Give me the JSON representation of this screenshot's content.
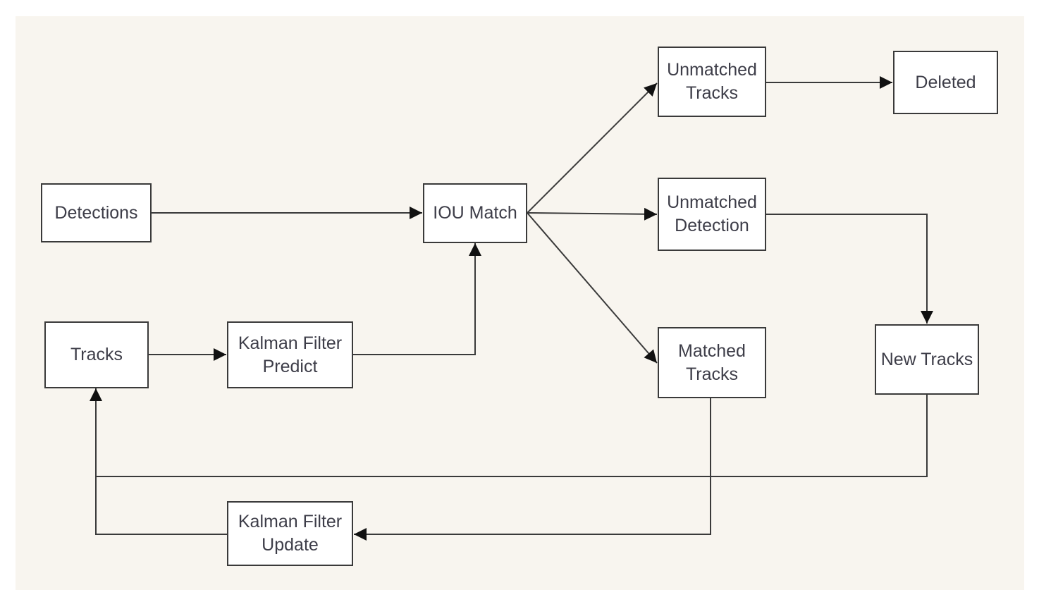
{
  "diagram": {
    "title": "",
    "nodes": [
      {
        "id": "detections",
        "label": "Detections"
      },
      {
        "id": "tracks",
        "label": "Tracks"
      },
      {
        "id": "kf_predict",
        "label": "Kalman Filter\nPredict"
      },
      {
        "id": "iou_match",
        "label": "IOU Match"
      },
      {
        "id": "unmatched_tracks",
        "label": "Unmatched\nTracks"
      },
      {
        "id": "deleted",
        "label": "Deleted"
      },
      {
        "id": "unmatched_detection",
        "label": "Unmatched\nDetection"
      },
      {
        "id": "matched_tracks",
        "label": "Matched\nTracks"
      },
      {
        "id": "new_tracks",
        "label": "New Tracks"
      },
      {
        "id": "kf_update",
        "label": "Kalman Filter\nUpdate"
      }
    ],
    "edges": [
      {
        "from": "detections",
        "to": "iou_match"
      },
      {
        "from": "tracks",
        "to": "kf_predict"
      },
      {
        "from": "kf_predict",
        "to": "iou_match"
      },
      {
        "from": "iou_match",
        "to": "unmatched_tracks"
      },
      {
        "from": "iou_match",
        "to": "unmatched_detection"
      },
      {
        "from": "iou_match",
        "to": "matched_tracks"
      },
      {
        "from": "unmatched_tracks",
        "to": "deleted"
      },
      {
        "from": "unmatched_detection",
        "to": "new_tracks"
      },
      {
        "from": "new_tracks",
        "to": "tracks"
      },
      {
        "from": "matched_tracks",
        "to": "kf_update"
      },
      {
        "from": "kf_update",
        "to": "tracks"
      }
    ]
  },
  "colors": {
    "background": "#f8f5ef",
    "box_fill": "#ffffff",
    "stroke": "#3a3a3a",
    "text": "#3d3d48"
  }
}
